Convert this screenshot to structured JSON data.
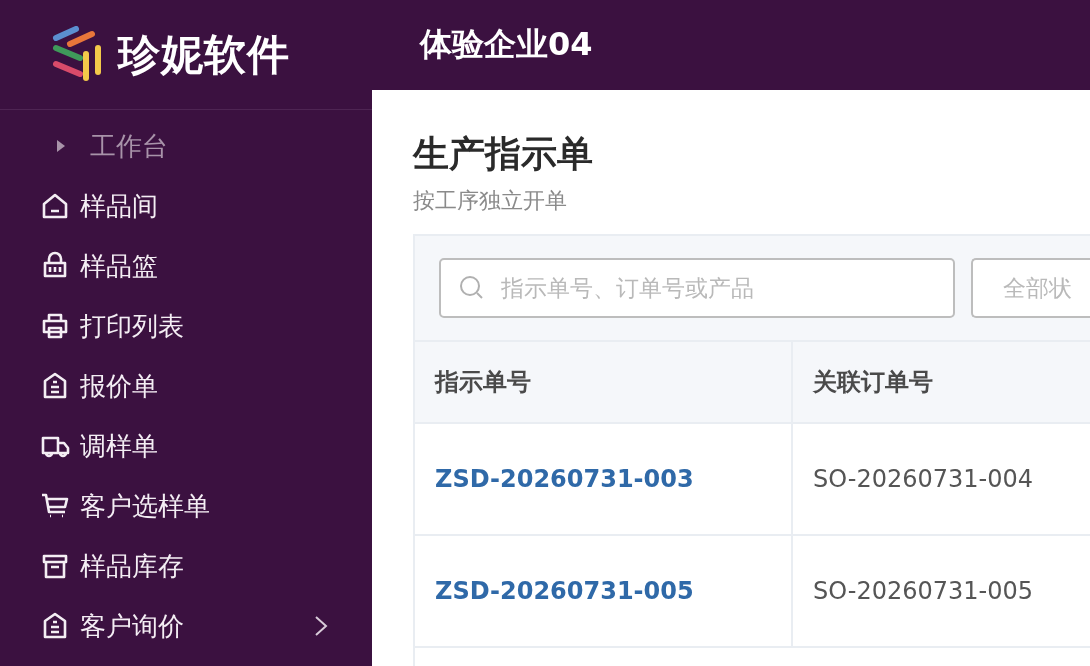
{
  "brand": {
    "name": "珍妮软件"
  },
  "header": {
    "company": "体验企业04"
  },
  "sidebar": {
    "items": [
      {
        "label": "工作台",
        "kind": "group",
        "has_submenu": false
      },
      {
        "label": "样品间",
        "kind": "link",
        "has_submenu": false
      },
      {
        "label": "样品篮",
        "kind": "link",
        "has_submenu": false
      },
      {
        "label": "打印列表",
        "kind": "link",
        "has_submenu": false
      },
      {
        "label": "报价单",
        "kind": "link",
        "has_submenu": false
      },
      {
        "label": "调样单",
        "kind": "link",
        "has_submenu": false
      },
      {
        "label": "客户选样单",
        "kind": "link",
        "has_submenu": false
      },
      {
        "label": "样品库存",
        "kind": "link",
        "has_submenu": false
      },
      {
        "label": "客户询价",
        "kind": "link",
        "has_submenu": true
      }
    ]
  },
  "page": {
    "title": "生产指示单",
    "subtitle": "按工序独立开单"
  },
  "filters": {
    "search": {
      "placeholder": "指示单号、订单号或产品"
    },
    "status": {
      "placeholder": "全部状"
    }
  },
  "table": {
    "columns": [
      "指示单号",
      "关联订单号"
    ],
    "rows": [
      {
        "cells": [
          "ZSD-20260731-003",
          "SO-20260731-004"
        ]
      },
      {
        "cells": [
          "ZSD-20260731-005",
          "SO-20260731-005"
        ]
      }
    ]
  }
}
